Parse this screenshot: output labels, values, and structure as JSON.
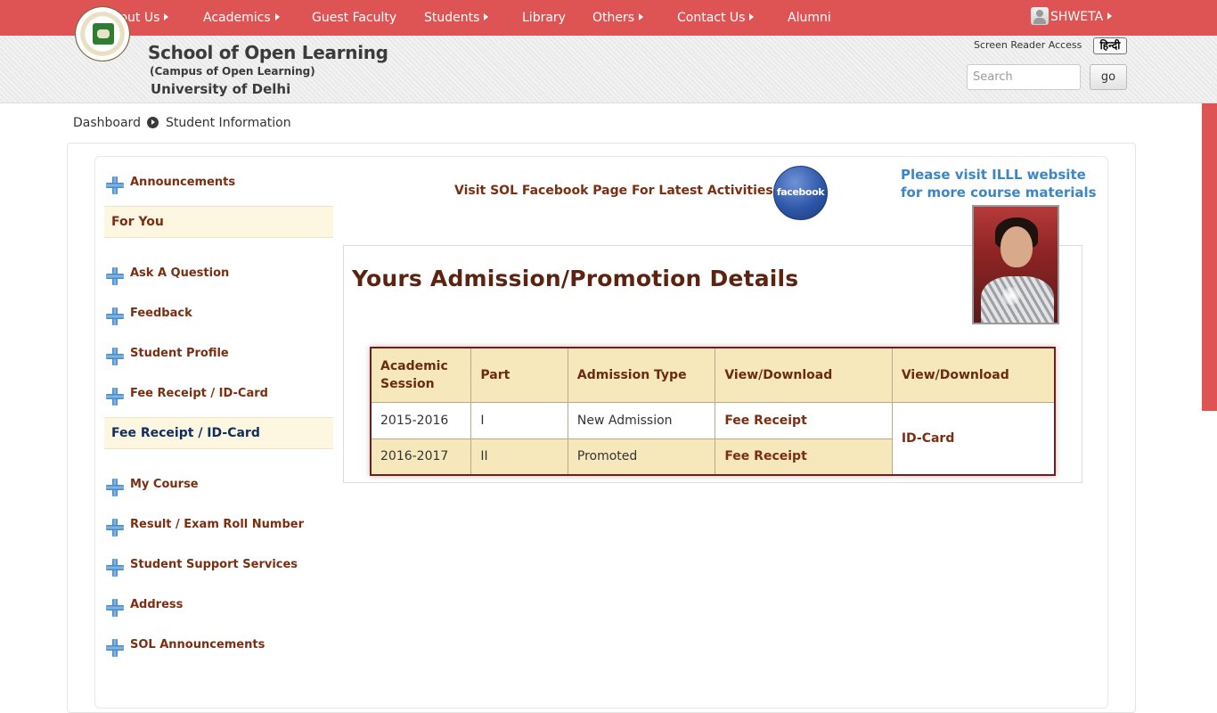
{
  "nav": {
    "about": "About Us",
    "academics": "Academics",
    "guest_faculty": "Guest Faculty",
    "students": "Students",
    "library": "Library",
    "others": "Others",
    "contact": "Contact Us",
    "alumni": "Alumni",
    "user": "SHWETA"
  },
  "header": {
    "brand_line1": "School of Open Learning",
    "brand_line2": "(Campus of Open Learning)",
    "brand_line3": "University of Delhi",
    "screen_reader": "Screen Reader Access",
    "hindi": "हिन्दी",
    "search_placeholder": "Search",
    "go": "go"
  },
  "breadcrumb": {
    "home": "Dashboard",
    "current": "Student Information"
  },
  "sidebar": {
    "items": [
      "Announcements",
      "For You",
      "Ask A Question",
      "Feedback",
      "Student Profile",
      "Fee Receipt / ID-Card",
      "Fee Receipt / ID-Card",
      "My Course",
      "Result / Exam Roll Number",
      "Student Support Services",
      "Address",
      "SOL Announcements"
    ],
    "colors": {
      "label": "#7a2e12",
      "active_heading_for_you": "#7a2e12",
      "active_heading_fee": "#0f2e5c"
    }
  },
  "main": {
    "facebook_text": "Visit SOL Facebook Page For Latest Activities",
    "facebook_icon_label": "facebook",
    "illl_line1": "Please visit ILLL website",
    "illl_line2": "for more course materials",
    "title": "Yours Admission/Promotion Details",
    "table": {
      "headers": [
        "Academic Session",
        "Part",
        "Admission Type",
        "View/Download",
        "View/Download"
      ],
      "rows": [
        {
          "session": "2015-2016",
          "part": "I",
          "type": "New Admission",
          "receipt": "Fee Receipt"
        },
        {
          "session": "2016-2017",
          "part": "II",
          "type": "Promoted",
          "receipt": "Fee Receipt"
        }
      ],
      "id_card": "ID-Card"
    }
  },
  "colors": {
    "accent": "#de5353",
    "table_header_bg": "#f6e8bb",
    "link_blue": "#3d86c6",
    "maroon": "#7a2e12"
  }
}
